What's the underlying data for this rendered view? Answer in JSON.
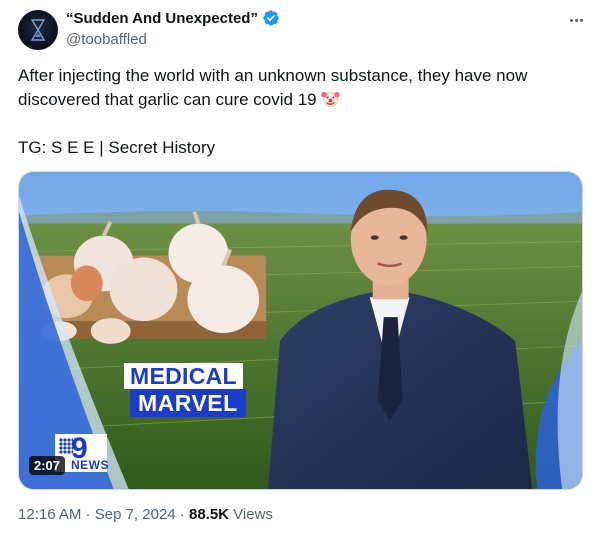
{
  "author": {
    "display_name": "“Sudden And Unexpected”",
    "handle": "@toobaffled",
    "verified_icon": "verified-badge-icon",
    "avatar_icon": "hourglass-icon"
  },
  "tweet": {
    "text_line1": "After injecting the world with an unknown substance, they have now",
    "text_line2": "discovered that garlic can cure covid 19",
    "emoji": "clown-face-emoji",
    "text_line3": "TG: S E E | Secret History"
  },
  "media": {
    "type": "video",
    "duration": "2:07",
    "caption_line1": "MEDICAL",
    "caption_line2": "MARVEL",
    "logo_text": "NEWS",
    "logo_number": "9"
  },
  "meta": {
    "time": "12:16 AM",
    "separator1": " · ",
    "date": "Sep 7, 2024",
    "separator2": " · ",
    "views_count": "88.5K",
    "views_label": " Views"
  },
  "colors": {
    "verified_blue": "#1d9bf0",
    "text_primary": "#0f1419",
    "text_secondary": "#536471",
    "news_blue": "#1b3cc9"
  }
}
